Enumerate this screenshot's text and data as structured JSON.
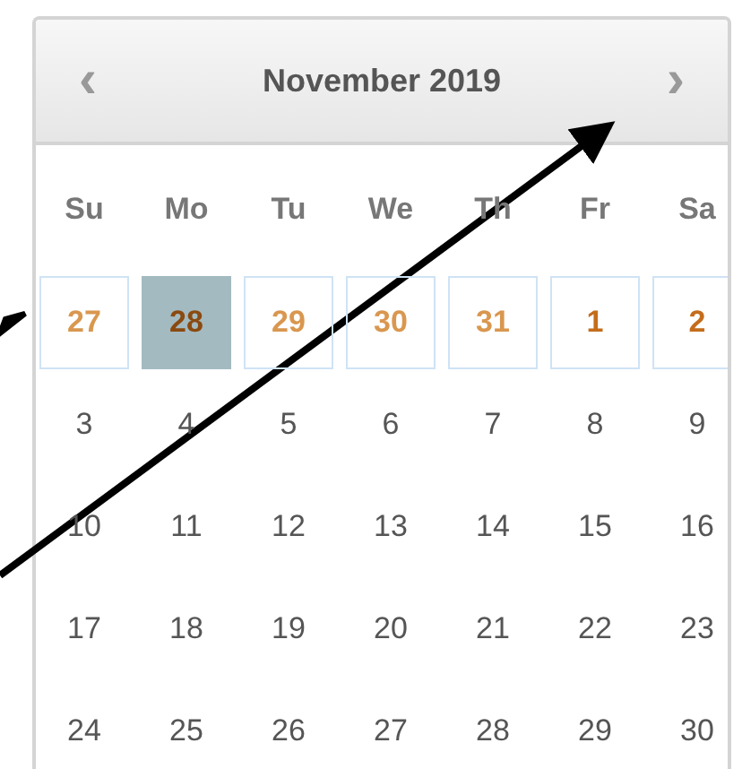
{
  "calendar": {
    "title": "November 2019",
    "prev_button": "‹",
    "next_button": "›",
    "weekdays": [
      "Su",
      "Mo",
      "Tu",
      "We",
      "Th",
      "Fr",
      "Sa"
    ],
    "weeks": [
      [
        {
          "label": "27",
          "kind": "prev-month",
          "selected": false
        },
        {
          "label": "28",
          "kind": "prev-month",
          "selected": true
        },
        {
          "label": "29",
          "kind": "prev-month",
          "selected": false
        },
        {
          "label": "30",
          "kind": "prev-month",
          "selected": false
        },
        {
          "label": "31",
          "kind": "prev-month",
          "selected": false
        },
        {
          "label": "1",
          "kind": "highlighted",
          "selected": false
        },
        {
          "label": "2",
          "kind": "highlighted",
          "selected": false
        }
      ],
      [
        {
          "label": "3",
          "kind": "plain",
          "selected": false
        },
        {
          "label": "4",
          "kind": "plain",
          "selected": false
        },
        {
          "label": "5",
          "kind": "plain",
          "selected": false
        },
        {
          "label": "6",
          "kind": "plain",
          "selected": false
        },
        {
          "label": "7",
          "kind": "plain",
          "selected": false
        },
        {
          "label": "8",
          "kind": "plain",
          "selected": false
        },
        {
          "label": "9",
          "kind": "plain",
          "selected": false
        }
      ],
      [
        {
          "label": "10",
          "kind": "plain",
          "selected": false
        },
        {
          "label": "11",
          "kind": "plain",
          "selected": false
        },
        {
          "label": "12",
          "kind": "plain",
          "selected": false
        },
        {
          "label": "13",
          "kind": "plain",
          "selected": false
        },
        {
          "label": "14",
          "kind": "plain",
          "selected": false
        },
        {
          "label": "15",
          "kind": "plain",
          "selected": false
        },
        {
          "label": "16",
          "kind": "plain",
          "selected": false
        }
      ],
      [
        {
          "label": "17",
          "kind": "plain",
          "selected": false
        },
        {
          "label": "18",
          "kind": "plain",
          "selected": false
        },
        {
          "label": "19",
          "kind": "plain",
          "selected": false
        },
        {
          "label": "20",
          "kind": "plain",
          "selected": false
        },
        {
          "label": "21",
          "kind": "plain",
          "selected": false
        },
        {
          "label": "22",
          "kind": "plain",
          "selected": false
        },
        {
          "label": "23",
          "kind": "plain",
          "selected": false
        }
      ],
      [
        {
          "label": "24",
          "kind": "plain",
          "selected": false
        },
        {
          "label": "25",
          "kind": "plain",
          "selected": false
        },
        {
          "label": "26",
          "kind": "plain",
          "selected": false
        },
        {
          "label": "27",
          "kind": "plain",
          "selected": false
        },
        {
          "label": "28",
          "kind": "plain",
          "selected": false
        },
        {
          "label": "29",
          "kind": "plain",
          "selected": false
        },
        {
          "label": "30",
          "kind": "plain",
          "selected": false
        }
      ]
    ]
  }
}
